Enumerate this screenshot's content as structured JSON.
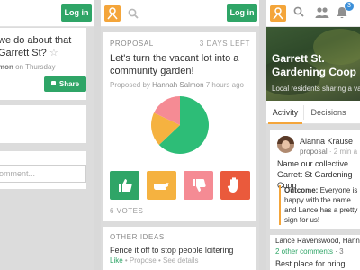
{
  "col1": {
    "login_label": "Log in",
    "title": "we do about that Garrett St?",
    "star": "☆",
    "meta_name": "mon",
    "meta_rest": " on Thursday",
    "share_label": "Share",
    "comment_placeholder": "omment..."
  },
  "col2": {
    "login_label": "Log in",
    "card": {
      "label": "PROPOSAL",
      "days_left": "3 DAYS LEFT",
      "title": "Let's turn the vacant lot into a community garden!",
      "proposed_by_prefix": "Proposed by ",
      "proposed_by_name": "Hannah Salmon",
      "proposed_time": " 7 hours ago",
      "votes": "6 VOTES"
    },
    "other": {
      "label": "OTHER IDEAS",
      "title": "Fence it off to stop people loitering",
      "like": "Like",
      "meta_rest": " • Propose • See details"
    }
  },
  "col3": {
    "badge": "3",
    "hero_title": "Garrett St. Gardening Coop",
    "hero_sub": "Local residents sharing a va",
    "tabs": [
      "Activity",
      "Decisions"
    ],
    "activity": {
      "name": "Alanna Krause",
      "action": "proposal",
      "time": " · 2 min a",
      "body": "Name our collective Garrett St Gardening Coop",
      "outcome_label": "Outcome:",
      "outcome_text": " Everyone is happy with the name and Lance has a pretty sign for us!"
    },
    "activity2": {
      "name": "Lance Ravenswood, Hannah",
      "comments": "2 other comments",
      "time": " · 3",
      "title": "Best place for bring"
    }
  },
  "colors": {
    "green": "#2fa567",
    "orange": "#f4a53a",
    "pink": "#f08c92",
    "red": "#ea5a3c",
    "blue": "#3b8fd9"
  },
  "pie": {
    "segments": [
      {
        "label": "yes",
        "value": 0.56,
        "color": "#2dbd77"
      },
      {
        "label": "abstain",
        "value": 0.17,
        "color": "#f5b240"
      },
      {
        "label": "no",
        "value": 0.16,
        "color": "#f58b94"
      }
    ]
  },
  "icons": [
    "logo-icon",
    "search-icon",
    "thumbs-up-icon",
    "hand-icon",
    "thumbs-down-icon",
    "stop-hand-icon",
    "people-icon",
    "bell-icon"
  ]
}
